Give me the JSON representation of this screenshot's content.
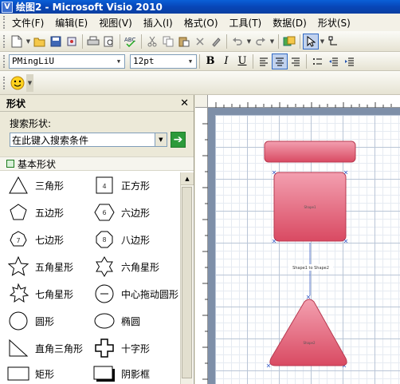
{
  "window": {
    "title": "绘图2 - Microsoft Visio 2010",
    "app_icon": "visio-icon"
  },
  "menu": [
    {
      "label": "文件(F)",
      "name": "menu-file"
    },
    {
      "label": "编辑(E)",
      "name": "menu-edit"
    },
    {
      "label": "视图(V)",
      "name": "menu-view"
    },
    {
      "label": "插入(I)",
      "name": "menu-insert"
    },
    {
      "label": "格式(O)",
      "name": "menu-format"
    },
    {
      "label": "工具(T)",
      "name": "menu-tools"
    },
    {
      "label": "数据(D)",
      "name": "menu-data"
    },
    {
      "label": "形状(S)",
      "name": "menu-shape"
    }
  ],
  "format_toolbar": {
    "font": "PMingLiU",
    "size": "12pt",
    "bold": "B",
    "italic": "I",
    "underline": "U",
    "active_alignment": "center"
  },
  "shapes_pane": {
    "title": "形状",
    "search_label": "搜索形状:",
    "search_placeholder": "在此键入搜索条件",
    "stencil_title": "基本形状",
    "shapes": [
      {
        "label": "三角形",
        "icon": "triangle-icon"
      },
      {
        "label": "正方形",
        "icon": "square-icon"
      },
      {
        "label": "五边形",
        "icon": "pentagon-icon"
      },
      {
        "label": "六边形",
        "icon": "hexagon-icon"
      },
      {
        "label": "七边形",
        "icon": "heptagon-icon"
      },
      {
        "label": "八边形",
        "icon": "octagon-icon"
      },
      {
        "label": "五角星形",
        "icon": "star5-icon"
      },
      {
        "label": "六角星形",
        "icon": "star6-icon"
      },
      {
        "label": "七角星形",
        "icon": "star7-icon"
      },
      {
        "label": "中心拖动圆形",
        "icon": "center-drag-circle-icon"
      },
      {
        "label": "圆形",
        "icon": "circle-icon"
      },
      {
        "label": "椭圆",
        "icon": "ellipse-icon"
      },
      {
        "label": "直角三角形",
        "icon": "right-triangle-icon"
      },
      {
        "label": "十字形",
        "icon": "cross-icon"
      },
      {
        "label": "矩形",
        "icon": "rectangle-icon"
      },
      {
        "label": "阴影框",
        "icon": "shadow-box-icon"
      }
    ],
    "square_icon_number": "4",
    "hexagon_icon_number": "6",
    "heptagon_icon_number": "7",
    "octagon_icon_number": "8"
  },
  "drawing": {
    "shape1_label": "Shape1",
    "shape2_label": "Shape2",
    "connector_label": "Shape1 to Shape2",
    "shape_fill": "#d94a62",
    "shape_fill_light": "#f3a0b0"
  }
}
